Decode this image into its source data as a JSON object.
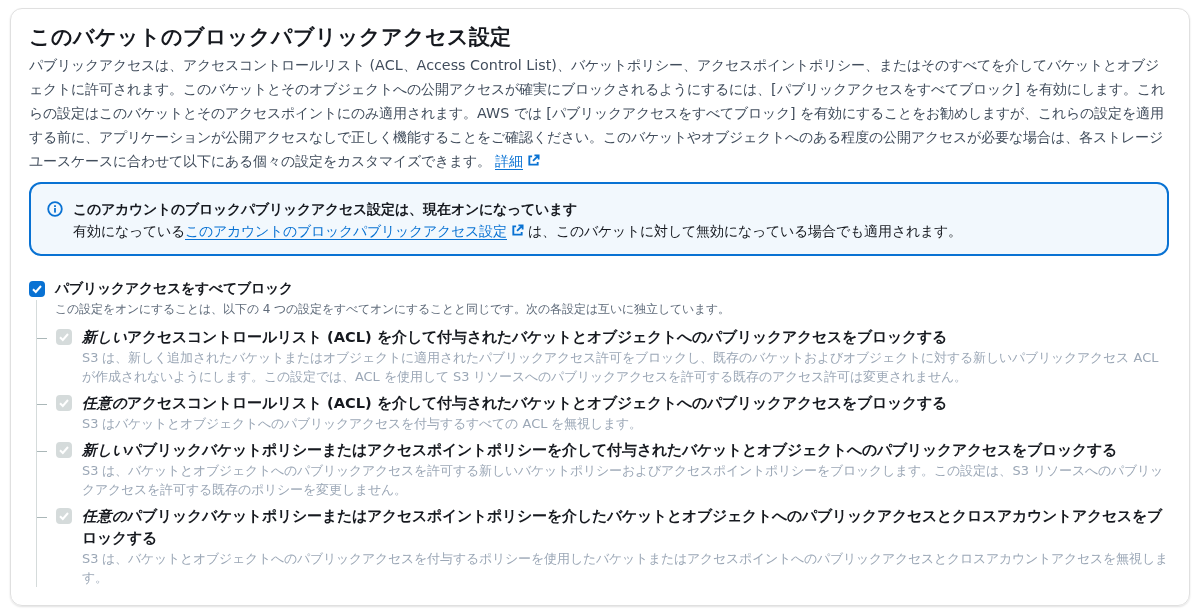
{
  "title": "このバケットのブロックパブリックアクセス設定",
  "description": {
    "text": "パブリックアクセスは、アクセスコントロールリスト (ACL、Access Control List)、バケットポリシー、アクセスポイントポリシー、またはそのすべてを介してバケットとオブジェクトに許可されます。このバケットとそのオブジェクトへの公開アクセスが確実にブロックされるようにするには、[パブリックアクセスをすべてブロック] を有効にします。これらの設定はこのバケットとそのアクセスポイントにのみ適用されます。AWS では [パブリックアクセスをすべてブロック] を有効にすることをお勧めしますが、これらの設定を適用する前に、アプリケーションが公開アクセスなしで正しく機能することをご確認ください。このバケットやオブジェクトへのある程度の公開アクセスが必要な場合は、各ストレージユースケースに合わせて以下にある個々の設定をカスタマイズできます。",
    "link": "詳細"
  },
  "info": {
    "title": "このアカウントのブロックパブリックアクセス設定は、現在オンになっています",
    "text_before": "有効になっている",
    "link": "このアカウントのブロックパブリックアクセス設定",
    "text_after": "は、このバケットに対して無効になっている場合でも適用されます。"
  },
  "master": {
    "label": "パブリックアクセスをすべてブロック",
    "checked": true,
    "description": "この設定をオンにすることは、以下の 4 つの設定をすべてオンにすることと同じです。次の各設定は互いに独立しています。"
  },
  "options": [
    {
      "emphasis": "新しい",
      "label": "アクセスコントロールリスト (ACL) を介して付与されたバケットとオブジェクトへのパブリックアクセスをブロックする",
      "description": "S3 は、新しく追加されたバケットまたはオブジェクトに適用されたパブリックアクセス許可をブロックし、既存のバケットおよびオブジェクトに対する新しいパブリックアクセス ACL が作成されないようにします。この設定では、ACL を使用して S3 リソースへのパブリックアクセスを許可する既存のアクセス許可は変更されません。",
      "checked": true,
      "disabled": true
    },
    {
      "emphasis": "任意の",
      "label": "アクセスコントロールリスト (ACL) を介して付与されたバケットとオブジェクトへのパブリックアクセスをブロックする",
      "description": "S3 はバケットとオブジェクトへのパブリックアクセスを付与するすべての ACL を無視します。",
      "checked": true,
      "disabled": true
    },
    {
      "emphasis": "新しい",
      "label": "パブリックバケットポリシーまたはアクセスポイントポリシーを介して付与されたバケットとオブジェクトへのパブリックアクセスをブロックする",
      "description": "S3 は、バケットとオブジェクトへのパブリックアクセスを許可する新しいバケットポリシーおよびアクセスポイントポリシーをブロックします。この設定は、S3 リソースへのパブリックアクセスを許可する既存のポリシーを変更しません。",
      "checked": true,
      "disabled": true
    },
    {
      "emphasis": "任意の",
      "label": "パブリックバケットポリシーまたはアクセスポイントポリシーを介したバケットとオブジェクトへのパブリックアクセスとクロスアカウントアクセスをブロックする",
      "description": "S3 は、バケットとオブジェクトへのパブリックアクセスを付与するポリシーを使用したバケットまたはアクセスポイントへのパブリックアクセスとクロスアカウントアクセスを無視します。",
      "checked": true,
      "disabled": true
    }
  ]
}
